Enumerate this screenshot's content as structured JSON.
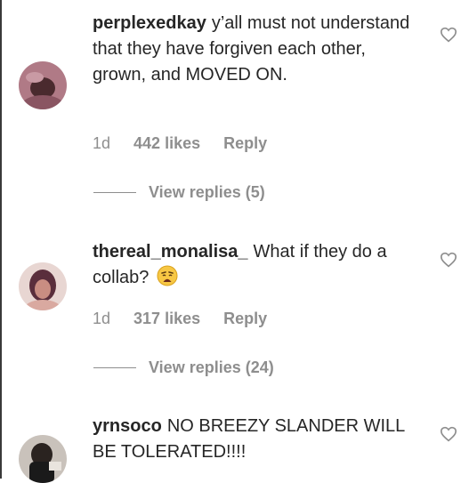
{
  "comments": [
    {
      "username": "perplexedkay",
      "text": "y’all must not understand that they have forgiven each other, grown, and MOVED ON.",
      "time": "1d",
      "likes": "442 likes",
      "reply_label": "Reply",
      "view_replies": "View replies (5)",
      "avatar_icon": "avatar-photo"
    },
    {
      "username": "thereal_monalisa_",
      "text": "What if they do a collab?",
      "emoji": "weary-face-emoji",
      "time": "1d",
      "likes": "317 likes",
      "reply_label": "Reply",
      "view_replies": "View replies (24)",
      "avatar_icon": "avatar-photo"
    },
    {
      "username": "yrnsoco",
      "text": "NO BREEZY SLANDER WILL BE TOLERATED!!!!",
      "avatar_icon": "avatar-photo"
    }
  ],
  "icons": {
    "like": "heart-outline-icon"
  },
  "colors": {
    "text": "#262626",
    "meta": "#8e8e8e"
  }
}
